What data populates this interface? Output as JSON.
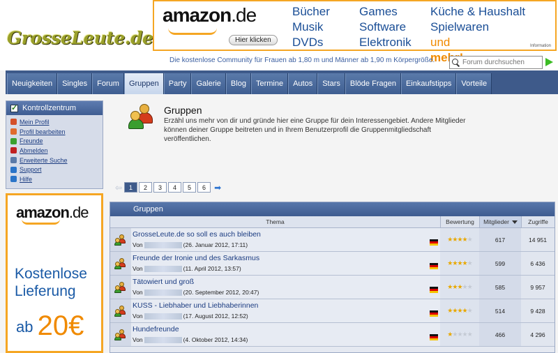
{
  "site": {
    "logo": "GrosseLeute.de",
    "tagline": "Die kostenlose Community für Frauen ab 1,80 m und Männer ab 1,90 m Körpergröße.",
    "search_placeholder": "Forum durchsuchen"
  },
  "ad_top": {
    "brand": "amazon",
    "tld": ".de",
    "cta": "Hier klicken",
    "col1": [
      "Bücher",
      "Musik",
      "DVDs"
    ],
    "col2": [
      "Games",
      "Software",
      "Elektronik"
    ],
    "col3": [
      "Küche & Haushalt",
      "Spielwaren"
    ],
    "mehr_prefix": "und ",
    "mehr_bold": "mehr!",
    "info": "Information"
  },
  "nav": {
    "tabs": [
      "Neuigkeiten",
      "Singles",
      "Forum",
      "Gruppen",
      "Party",
      "Galerie",
      "Blog",
      "Termine",
      "Autos",
      "Stars",
      "Blöde Fragen",
      "Einkaufstipps",
      "Vorteile"
    ],
    "active": "Gruppen"
  },
  "sidebar": {
    "title": "Kontrollzentrum",
    "items": [
      {
        "label": "Mein Profil",
        "icon": "user-icon",
        "color": "#d4502a"
      },
      {
        "label": "Profil bearbeiten",
        "icon": "edit-profile-icon",
        "color": "#e06b2e"
      },
      {
        "label": "Freunde",
        "icon": "friends-icon",
        "color": "#3aa02e"
      },
      {
        "label": "Abmelden",
        "icon": "logout-icon",
        "color": "#c02020"
      },
      {
        "label": "Erweiterte Suche",
        "icon": "search-icon",
        "color": "#5a7aa8"
      },
      {
        "label": "Support",
        "icon": "support-icon",
        "color": "#2a74c8"
      },
      {
        "label": "Hilfe",
        "icon": "help-icon",
        "color": "#2a74c8"
      }
    ]
  },
  "ad_side": {
    "brand": "amazon",
    "tld": ".de",
    "line1": "Kostenlose",
    "line2": "Lieferung",
    "ab": "ab",
    "amount": "20€"
  },
  "intro": {
    "title": "Gruppen",
    "text": "Erzähl uns mehr von dir und gründe hier eine Gruppe für dein Interessengebiet. Andere Mitglieder können deiner Gruppe beitreten und in Ihrem Benutzerprofil die Gruppenmitgliedschaft veröffentlichen."
  },
  "pager": {
    "pages": [
      "1",
      "2",
      "3",
      "4",
      "5",
      "6"
    ],
    "current": "1"
  },
  "table": {
    "title": "Gruppen",
    "headers": {
      "thema": "Thema",
      "bewertung": "Bewertung",
      "mitglieder": "Mitglieder",
      "zugriffe": "Zugriffe"
    },
    "rows": [
      {
        "title": "GrosseLeute.de so soll es auch bleiben",
        "von": "Von",
        "date": "(26. Januar 2012, 17:11)",
        "stars": 4,
        "members": "617",
        "hits": "14 951"
      },
      {
        "title": "Freunde der Ironie und des Sarkasmus",
        "von": "Von",
        "date": "(11. April 2012, 13:57)",
        "stars": 4,
        "members": "599",
        "hits": "6 436"
      },
      {
        "title": "Tätowiert und groß",
        "von": "Von",
        "date": "(20. September 2012, 20:47)",
        "stars": 3,
        "members": "585",
        "hits": "9 957"
      },
      {
        "title": "KUSS - Liebhaber und Liebhaberinnen",
        "von": "Von",
        "date": "(17. August 2012, 12:52)",
        "stars": 4,
        "members": "514",
        "hits": "9 428"
      },
      {
        "title": "Hundefreunde",
        "von": "Von",
        "date": "(4. Oktober 2012, 14:34)",
        "stars": 1,
        "members": "466",
        "hits": "4 296"
      }
    ]
  },
  "colors": {
    "nav": "#3e5a8a",
    "accent": "#f5a623",
    "link": "#1a3b80"
  }
}
